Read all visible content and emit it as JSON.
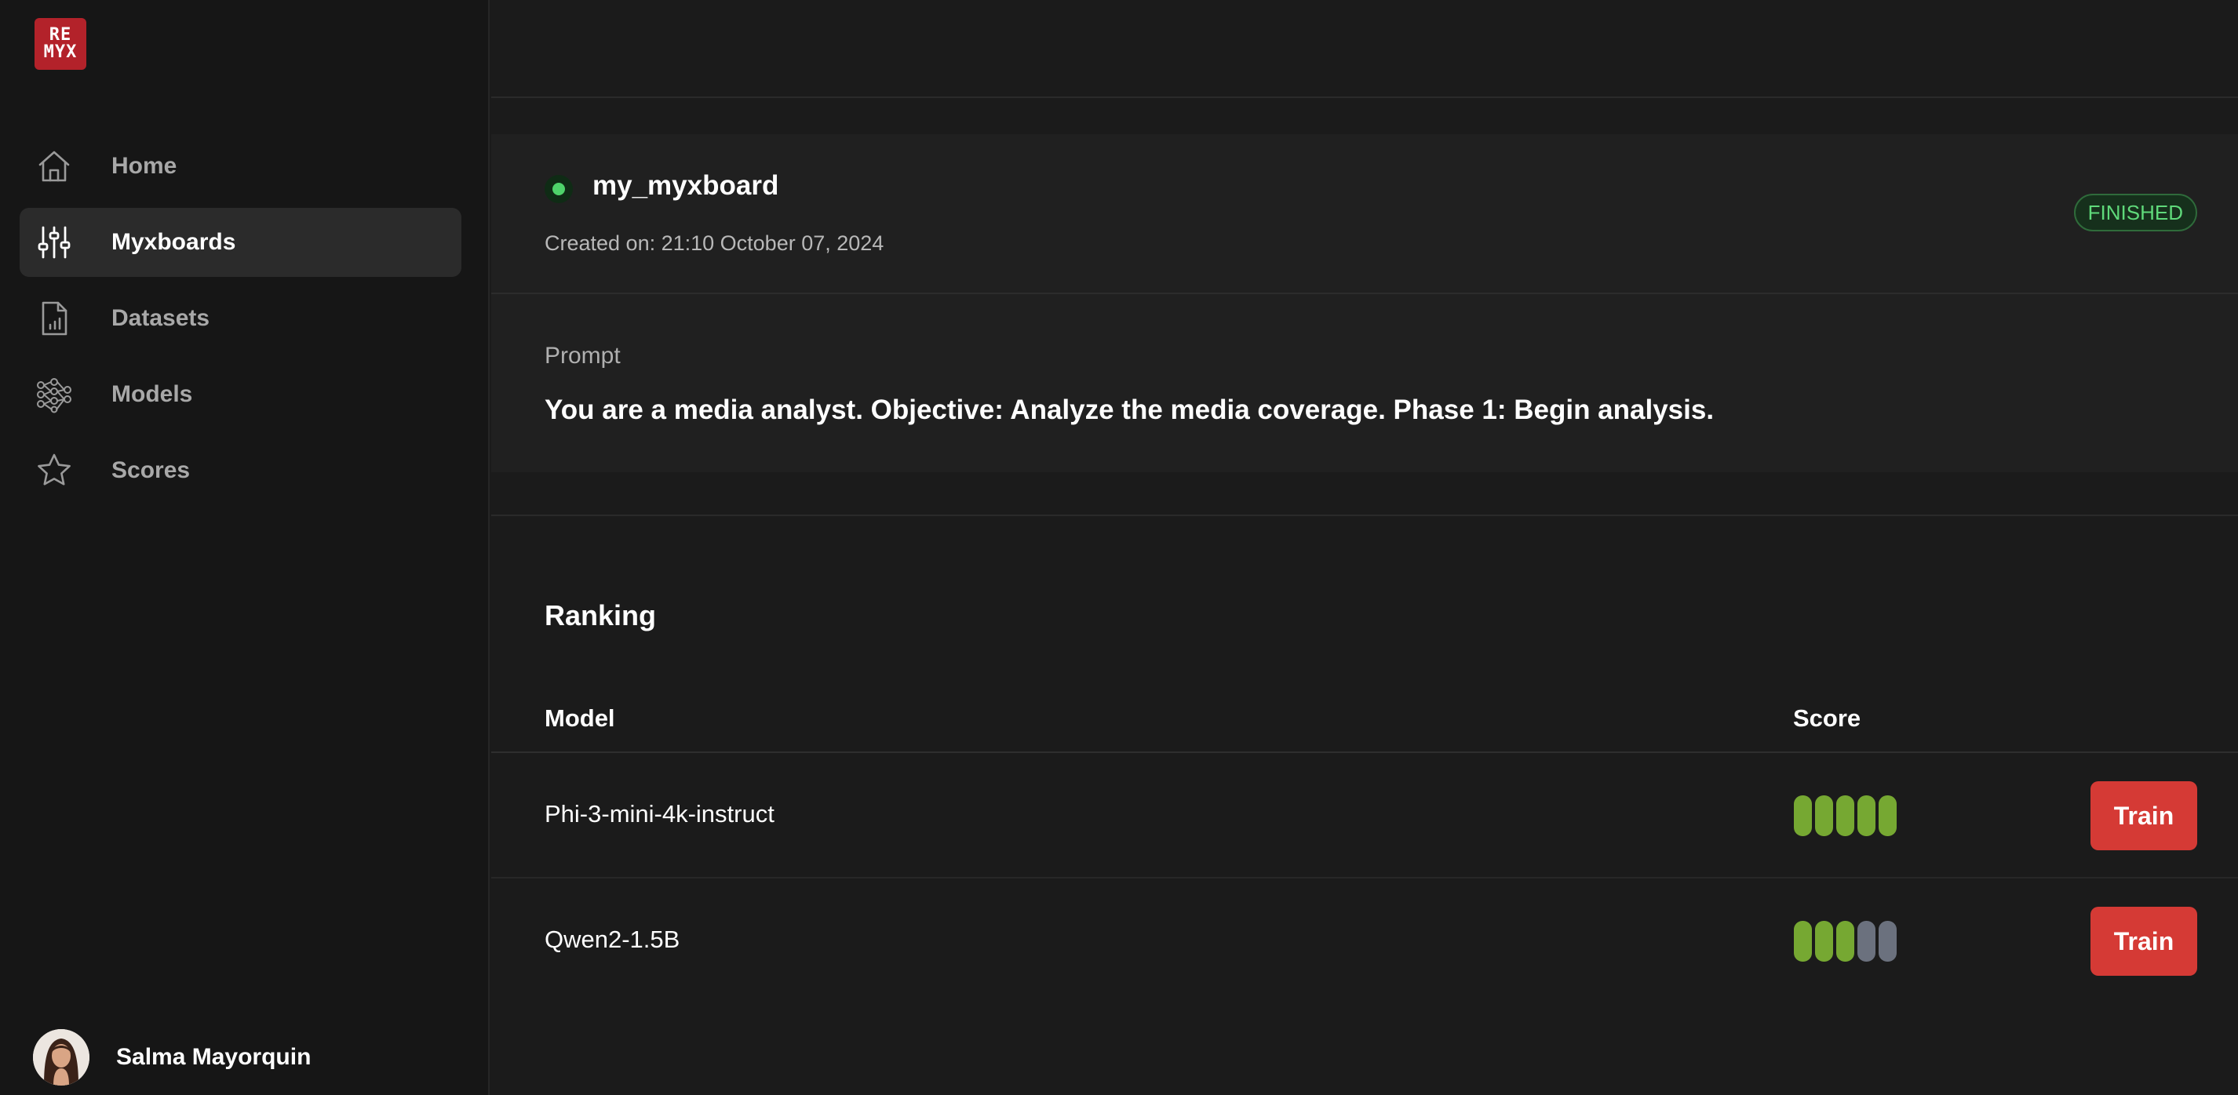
{
  "logo": {
    "line1": "RE",
    "line2": "MYX"
  },
  "sidebar": {
    "items": [
      {
        "label": "Home",
        "icon": "home-icon",
        "active": false
      },
      {
        "label": "Myxboards",
        "icon": "sliders-icon",
        "active": true
      },
      {
        "label": "Datasets",
        "icon": "file-chart-icon",
        "active": false
      },
      {
        "label": "Models",
        "icon": "network-icon",
        "active": false
      },
      {
        "label": "Scores",
        "icon": "star-icon",
        "active": false
      }
    ],
    "user": {
      "name": "Salma Mayorquin"
    }
  },
  "board": {
    "name": "my_myxboard",
    "created": "Created on: 21:10 October 07, 2024",
    "status": "FINISHED",
    "status_color": "#5fd97a",
    "prompt_label": "Prompt",
    "prompt_text": "You are a media analyst. Objective: Analyze the media coverage. Phase 1: Begin analysis."
  },
  "ranking": {
    "title": "Ranking",
    "columns": {
      "model": "Model",
      "score": "Score"
    },
    "rows": [
      {
        "model": "Phi-3-mini-4k-instruct",
        "score": 5,
        "max_score": 5,
        "action": "Train"
      },
      {
        "model": "Qwen2-1.5B",
        "score": 3,
        "max_score": 5,
        "action": "Train"
      }
    ],
    "colors": {
      "filled": "#76a832",
      "empty": "#6b717e",
      "train_button": "#d53a35"
    }
  }
}
